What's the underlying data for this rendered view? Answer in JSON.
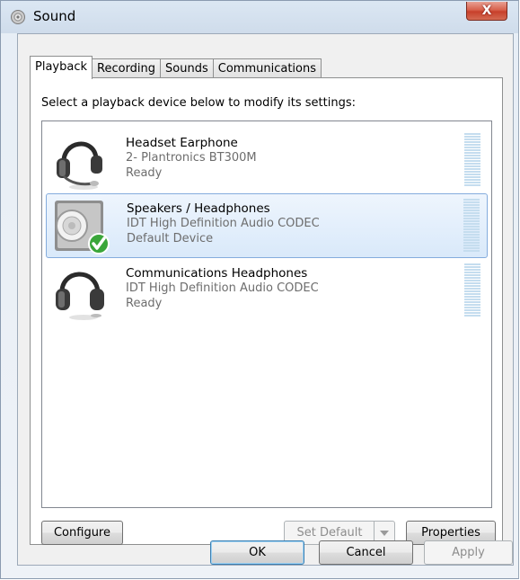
{
  "window": {
    "title": "Sound",
    "close_glyph": "X"
  },
  "tabs": [
    {
      "label": "Playback"
    },
    {
      "label": "Recording"
    },
    {
      "label": "Sounds"
    },
    {
      "label": "Communications"
    }
  ],
  "panel": {
    "instruction": "Select a playback device below to modify its settings:"
  },
  "devices": [
    {
      "name": "Headset Earphone",
      "description": "2- Plantronics BT300M",
      "status": "Ready",
      "icon": "headset-icon",
      "selected": false
    },
    {
      "name": "Speakers / Headphones",
      "description": "IDT High Definition Audio CODEC",
      "status": "Default Device",
      "icon": "speaker-icon",
      "selected": true
    },
    {
      "name": "Communications Headphones",
      "description": "IDT High Definition Audio CODEC",
      "status": "Ready",
      "icon": "headphones-icon",
      "selected": false
    }
  ],
  "panel_buttons": {
    "configure": "Configure",
    "set_default": "Set Default",
    "properties": "Properties"
  },
  "dialog_buttons": {
    "ok": "OK",
    "cancel": "Cancel",
    "apply": "Apply"
  },
  "colors": {
    "selection_border": "#84acdd",
    "selection_fill": "#d9e9fa",
    "meter": "#c5ddef",
    "check_green": "#3aa63a"
  }
}
